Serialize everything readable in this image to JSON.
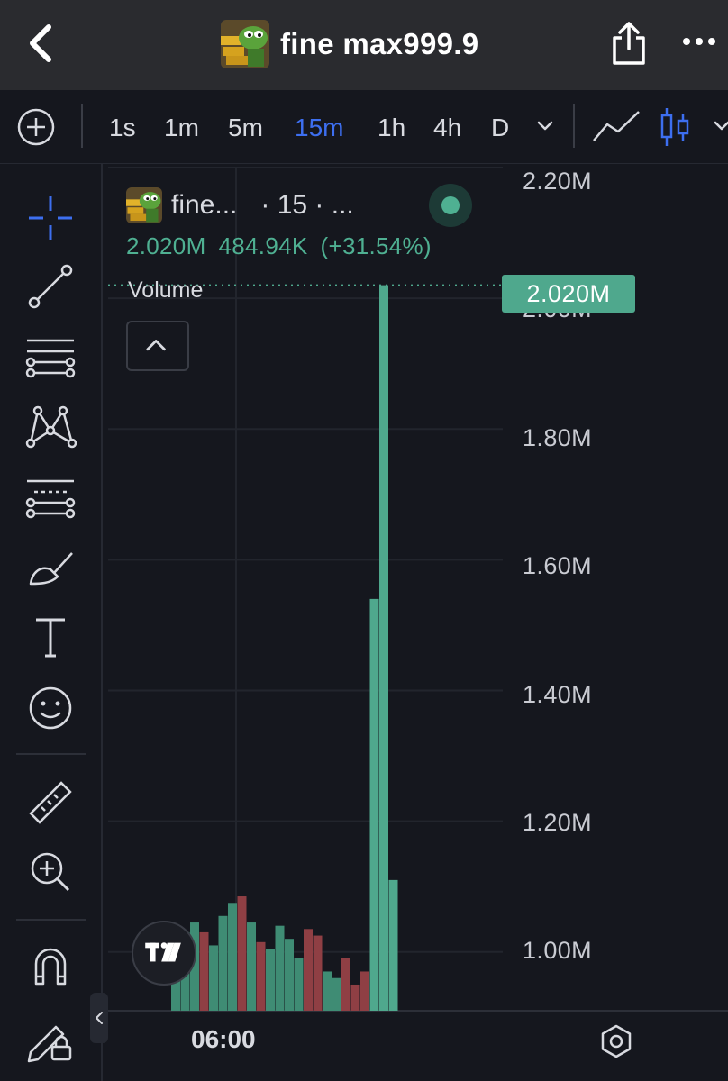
{
  "header": {
    "title": "fine max999.9",
    "back_icon": "chevron-left-icon",
    "share_icon": "share-icon",
    "more_icon": "more-dots-icon"
  },
  "toolbar": {
    "timeframes": [
      "1s",
      "1m",
      "5m",
      "15m",
      "1h",
      "4h",
      "D"
    ],
    "active_timeframe": "15m",
    "accent_color": "#3d6ff0"
  },
  "legend": {
    "name": "fine...",
    "interval": "· 15 · ...",
    "volume": "2.020M",
    "change": "484.94K",
    "change_pct": "(+31.54%)",
    "indicator_label": "Volume"
  },
  "price_tag": "2.020M",
  "time_label": "06:00",
  "colors": {
    "up": "#4fa88d",
    "down": "#a64b4e",
    "background": "#15171e"
  },
  "chart_data": {
    "type": "bar",
    "y_tick_labels": [
      "2.20M",
      "2.00M",
      "1.80M",
      "1.60M",
      "1.40M",
      "1.20M",
      "1.00M"
    ],
    "y_ticks": [
      2200000,
      2000000,
      1800000,
      1600000,
      1400000,
      1200000,
      1000000
    ],
    "ylim": [
      910000,
      2200000
    ],
    "current_value": 2020000,
    "volume_bars": [
      {
        "v": 1000000,
        "dir": "up"
      },
      {
        "v": 1030000,
        "dir": "up"
      },
      {
        "v": 1045000,
        "dir": "up"
      },
      {
        "v": 1030000,
        "dir": "down"
      },
      {
        "v": 1010000,
        "dir": "up"
      },
      {
        "v": 1055000,
        "dir": "up"
      },
      {
        "v": 1075000,
        "dir": "up"
      },
      {
        "v": 1085000,
        "dir": "down"
      },
      {
        "v": 1045000,
        "dir": "up"
      },
      {
        "v": 1015000,
        "dir": "down"
      },
      {
        "v": 1005000,
        "dir": "up"
      },
      {
        "v": 1040000,
        "dir": "up"
      },
      {
        "v": 1020000,
        "dir": "up"
      },
      {
        "v": 990000,
        "dir": "up"
      },
      {
        "v": 1035000,
        "dir": "down"
      },
      {
        "v": 1025000,
        "dir": "down"
      },
      {
        "v": 970000,
        "dir": "up"
      },
      {
        "v": 960000,
        "dir": "up"
      },
      {
        "v": 990000,
        "dir": "down"
      },
      {
        "v": 950000,
        "dir": "down"
      },
      {
        "v": 970000,
        "dir": "down"
      },
      {
        "v": 1540000,
        "dir": "up"
      },
      {
        "v": 2020000,
        "dir": "up"
      },
      {
        "v": 1110000,
        "dir": "up"
      }
    ]
  }
}
